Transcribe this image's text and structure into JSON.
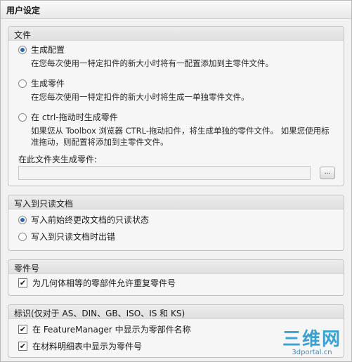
{
  "title": "用户设定",
  "file_group": {
    "header": "文件",
    "options": [
      {
        "label": "生成配置",
        "desc": "在您每次使用一特定扣件的新大小时将有一配置添加到主零件文件。",
        "selected": true
      },
      {
        "label": "生成零件",
        "desc": "在您每次使用一特定扣件的新大小时将生成一单独零件文件。",
        "selected": false
      },
      {
        "label": "在 ctrl-拖动时生成零件",
        "desc": "如果您从 Toolbox 浏览器 CTRL-拖动扣件，将生成单独的零件文件。 如果您使用标准拖动，则配置将添加到主零件文件。",
        "selected": false
      }
    ],
    "folder_label": "在此文件夹生成零件:",
    "folder_value": "",
    "browse_label": "..."
  },
  "readonly_group": {
    "header": "写入到只读文档",
    "options": [
      {
        "label": "写入前始终更改文档的只读状态",
        "selected": true
      },
      {
        "label": "写入到只读文档时出错",
        "selected": false
      }
    ]
  },
  "partnum_group": {
    "header": "零件号",
    "checkbox_label": "为几何体相等的零部件允许重复零件号",
    "checked": true
  },
  "ident_group": {
    "header": "标识(仅对于 AS、DIN、GB、ISO、IS 和 KS)",
    "items": [
      {
        "label": "在 FeatureManager 中显示为零部件名称",
        "checked": true
      },
      {
        "label": "在材料明细表中显示为零件号",
        "checked": true
      }
    ]
  },
  "watermark": {
    "main": "三维网",
    "sub": "3dportal.cn"
  }
}
